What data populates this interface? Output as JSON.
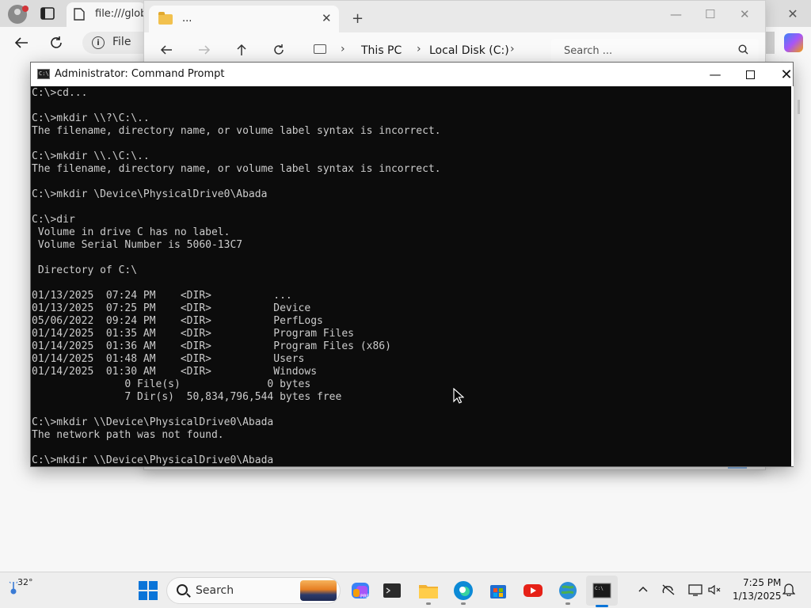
{
  "browser": {
    "tab_title": "file:///globa",
    "url_label": "File"
  },
  "explorer": {
    "tab_title": "...",
    "breadcrumb": [
      "This PC",
      "Local Disk (C:)"
    ],
    "search_placeholder": "Search ..."
  },
  "cmd": {
    "title": "Administrator: Command Prompt",
    "icon_text": "C:\\",
    "lines": [
      "C:\\>cd...",
      "",
      "C:\\>mkdir \\\\?\\C:\\..",
      "The filename, directory name, or volume label syntax is incorrect.",
      "",
      "C:\\>mkdir \\\\.\\C:\\..",
      "The filename, directory name, or volume label syntax is incorrect.",
      "",
      "C:\\>mkdir \\Device\\PhysicalDrive0\\Abada",
      "",
      "C:\\>dir",
      " Volume in drive C has no label.",
      " Volume Serial Number is 5060-13C7",
      "",
      " Directory of C:\\",
      "",
      "01/13/2025  07:24 PM    <DIR>          ...",
      "01/13/2025  07:25 PM    <DIR>          Device",
      "05/06/2022  09:24 PM    <DIR>          PerfLogs",
      "01/14/2025  01:35 AM    <DIR>          Program Files",
      "01/14/2025  01:36 AM    <DIR>          Program Files (x86)",
      "01/14/2025  01:48 AM    <DIR>          Users",
      "01/14/2025  01:30 AM    <DIR>          Windows",
      "               0 File(s)              0 bytes",
      "               7 Dir(s)  50,834,796,544 bytes free",
      "",
      "C:\\>mkdir \\\\Device\\PhysicalDrive0\\Abada",
      "The network path was not found.",
      "",
      "C:\\>mkdir \\\\Device\\PhysicalDrive0\\Abada"
    ]
  },
  "taskbar": {
    "weather_temp": "32°",
    "search_label": "Search",
    "time": "7:25 PM",
    "date": "1/13/2025",
    "apps": [
      "copilot-icon",
      "terminal-icon",
      "file-explorer-icon",
      "edge-icon",
      "store-icon",
      "youtube-icon",
      "network-globe-icon",
      "command-prompt-icon"
    ]
  }
}
